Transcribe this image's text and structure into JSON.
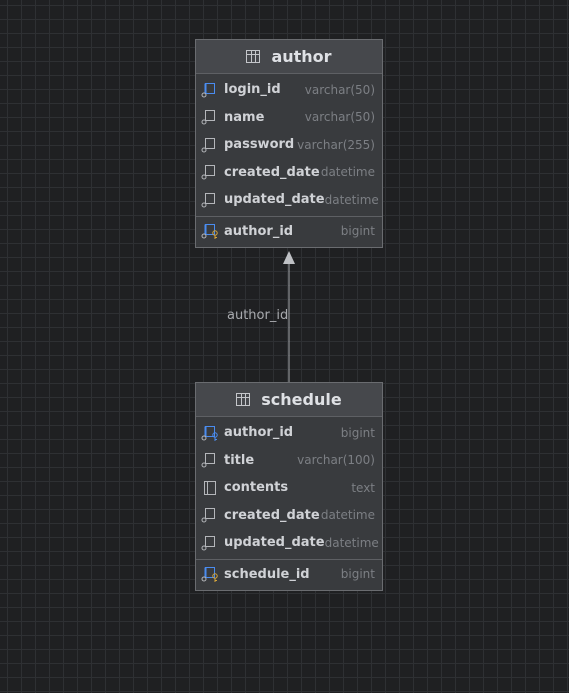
{
  "tables": {
    "author": {
      "name": "author",
      "columns": [
        {
          "name": "login_id",
          "type": "varchar(50)",
          "icon": "column-indexed-icon"
        },
        {
          "name": "name",
          "type": "varchar(50)",
          "icon": "column-icon"
        },
        {
          "name": "password",
          "type": "varchar(255)",
          "icon": "column-icon"
        },
        {
          "name": "created_date",
          "type": "datetime",
          "icon": "column-icon"
        },
        {
          "name": "updated_date",
          "type": "datetime",
          "icon": "column-icon"
        }
      ],
      "primary_key": {
        "name": "author_id",
        "type": "bigint",
        "icon": "primary-key-column-icon"
      }
    },
    "schedule": {
      "name": "schedule",
      "columns": [
        {
          "name": "author_id",
          "type": "bigint",
          "icon": "foreign-key-column-icon"
        },
        {
          "name": "title",
          "type": "varchar(100)",
          "icon": "column-icon"
        },
        {
          "name": "contents",
          "type": "text",
          "icon": "column-nullable-icon"
        },
        {
          "name": "created_date",
          "type": "datetime",
          "icon": "column-icon"
        },
        {
          "name": "updated_date",
          "type": "datetime",
          "icon": "column-icon"
        }
      ],
      "primary_key": {
        "name": "schedule_id",
        "type": "bigint",
        "icon": "primary-key-column-icon"
      }
    }
  },
  "relation": {
    "label": "author_id",
    "from": "schedule",
    "to": "author"
  },
  "colors": {
    "background": "#1f2022",
    "card": "#393b3e",
    "key_blue": "#4a8cf0",
    "key_gold": "#d6a63c"
  }
}
